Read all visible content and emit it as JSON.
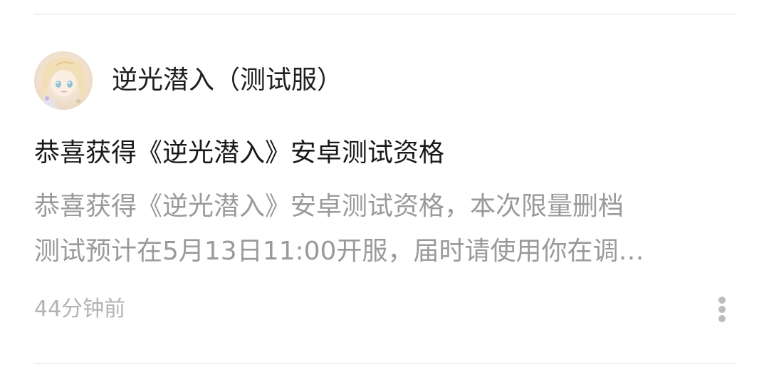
{
  "post": {
    "author": {
      "name": "逆光潜入（测试服）",
      "avatar_icon": "anime-avatar-icon"
    },
    "title": "恭喜获得《逆光潜入》安卓测试资格",
    "summary_lines": [
      "恭喜获得《逆光潜入》安卓测试资格，本次限量删档",
      "测试预计在5月13日11:00开服，届时请使用你在调…"
    ],
    "timestamp": "44分钟前",
    "more_icon": "more-vertical-icon"
  },
  "colors": {
    "background": "#ffffff",
    "title_text": "#1a1a1a",
    "summary_text": "#9a9a9a",
    "timestamp_text": "#b3b3b3",
    "divider": "#f1f1f1"
  }
}
